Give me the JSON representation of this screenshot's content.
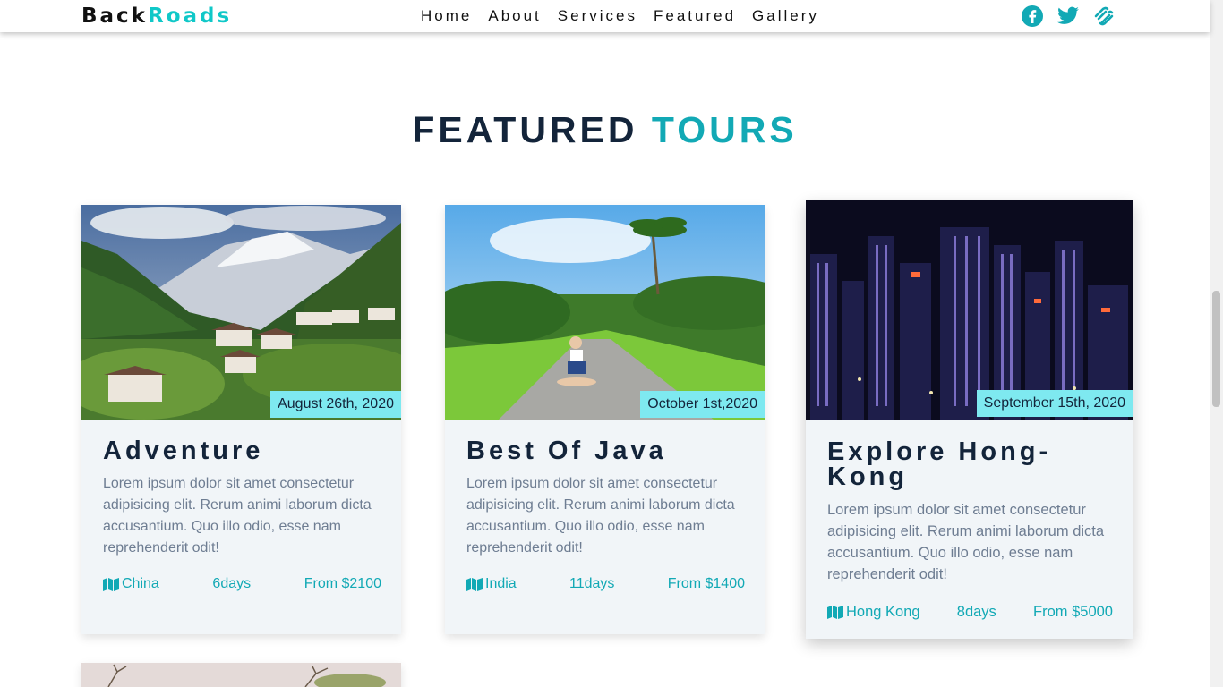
{
  "brand": {
    "back": "Back",
    "roads": "Roads"
  },
  "nav": {
    "links": [
      "Home",
      "About",
      "Services",
      "Featured",
      "Gallery"
    ]
  },
  "social": [
    "facebook-icon",
    "twitter-icon",
    "squarespace-icon"
  ],
  "colors": {
    "accent": "#12a9b5",
    "date_badge": "#7ee9f0",
    "dark": "#13243a",
    "card_bg": "#f1f5f8"
  },
  "section": {
    "title_part1": "FEATURED",
    "title_part2": "TOURS"
  },
  "tours": [
    {
      "title": "Adventure",
      "date": "August 26th, 2020",
      "text": "Lorem ipsum dolor sit amet consectetur adipisicing elit. Rerum animi laborum dicta accusantium. Quo illo odio, esse nam reprehenderit odit!",
      "location": "China",
      "duration": "6days",
      "price": "From $2100"
    },
    {
      "title": "Best Of Java",
      "date": "October 1st,2020",
      "text": "Lorem ipsum dolor sit amet consectetur adipisicing elit. Rerum animi laborum dicta accusantium. Quo illo odio, esse nam reprehenderit odit!",
      "location": "India",
      "duration": "11days",
      "price": "From $1400"
    },
    {
      "title": "Explore Hong-Kong",
      "date": "September 15th, 2020",
      "text": "Lorem ipsum dolor sit amet consectetur adipisicing elit. Rerum animi laborum dicta accusantium. Quo illo odio, esse nam reprehenderit odit!",
      "location": "Hong Kong",
      "duration": "8days",
      "price": "From $5000"
    }
  ]
}
